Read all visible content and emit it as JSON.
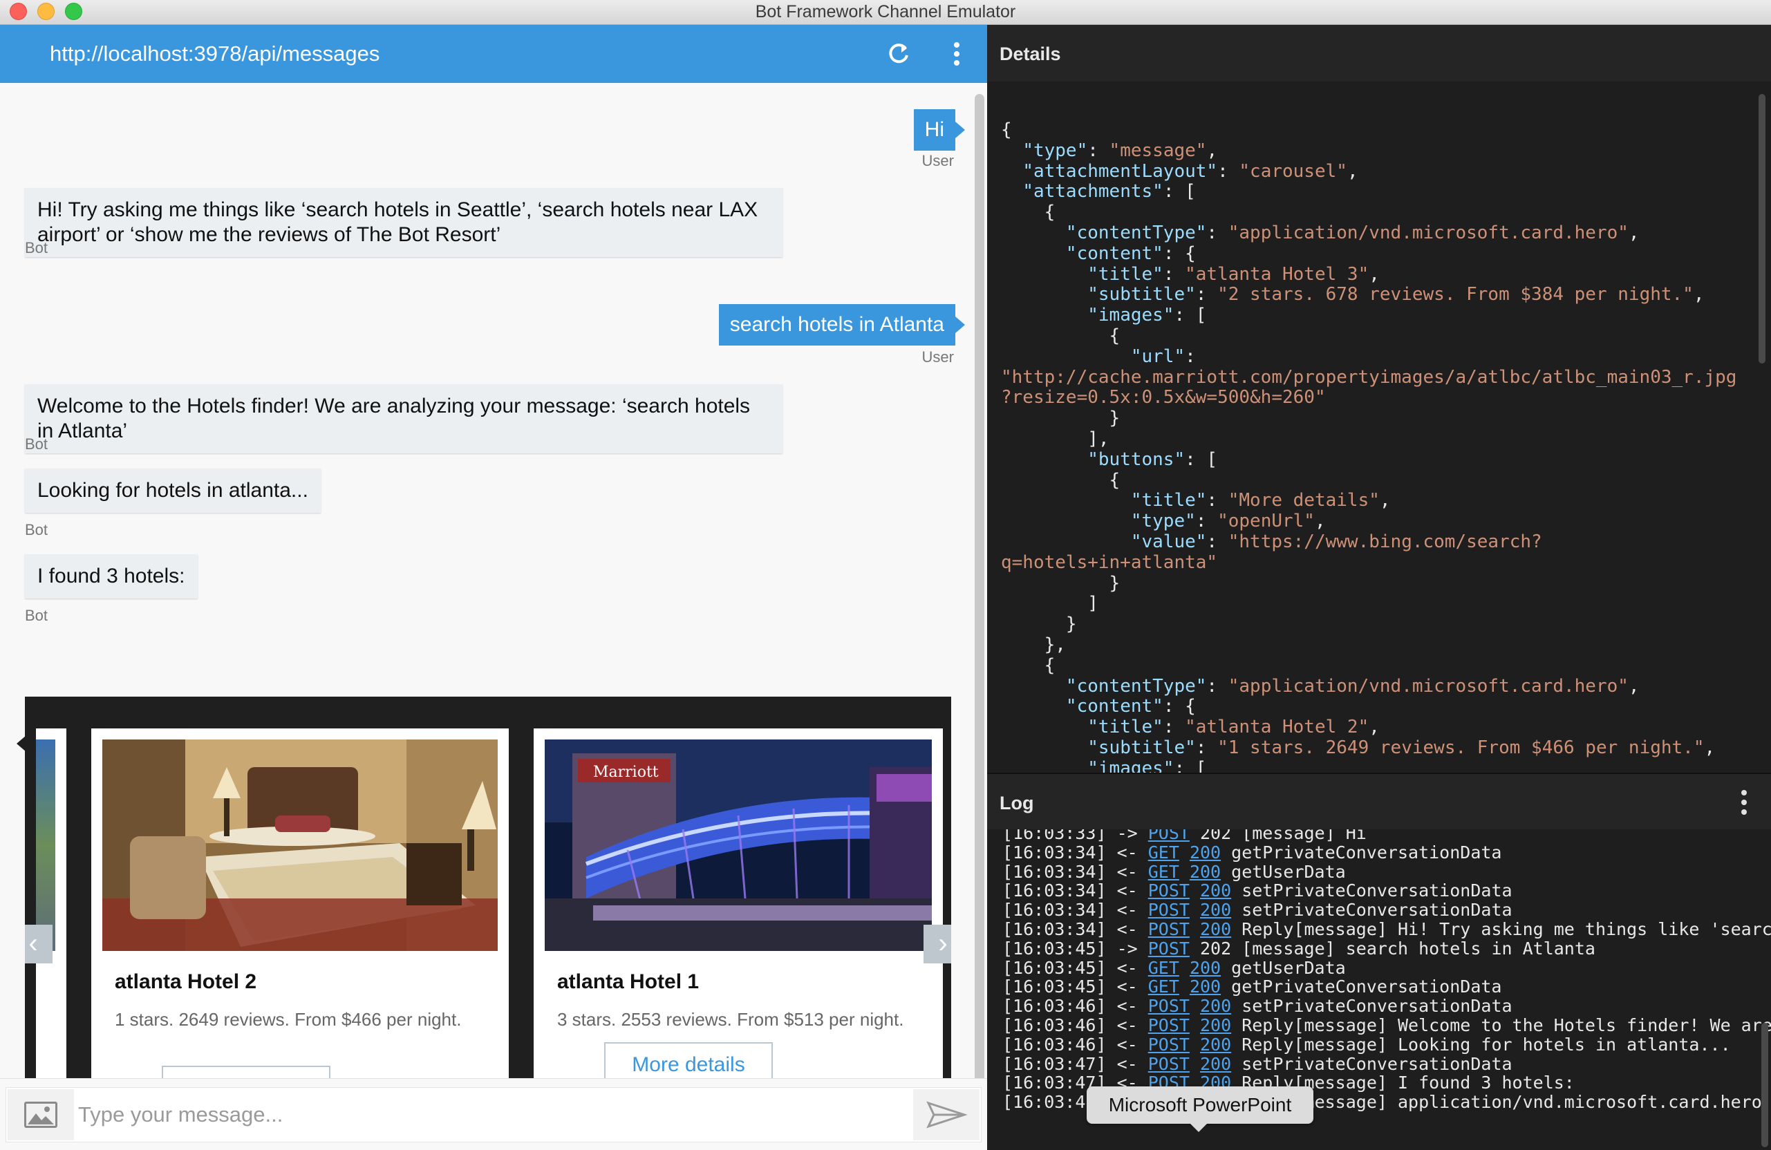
{
  "window": {
    "title": "Bot Framework Channel Emulator"
  },
  "chat": {
    "endpoint": "http://localhost:3978/api/messages",
    "messages": [
      {
        "from": "user",
        "text": "Hi",
        "sender": "User"
      },
      {
        "from": "bot",
        "text": "Hi! Try asking me things like ‘search hotels in Seattle’, ‘search hotels near LAX airport’ or ‘show me the reviews of The Bot Resort’",
        "sender": "Bot"
      },
      {
        "from": "user",
        "text": "search hotels in Atlanta",
        "sender": "User"
      },
      {
        "from": "bot",
        "text": "Welcome to the Hotels finder! We are analyzing your message: ‘search hotels in Atlanta’",
        "sender": "Bot"
      },
      {
        "from": "bot",
        "text": "Looking for hotels in atlanta...",
        "sender": "Bot"
      },
      {
        "from": "bot",
        "text": "I found 3 hotels:",
        "sender": "Bot"
      }
    ],
    "cards": [
      {
        "title": "atlanta Hotel 2",
        "subtitle": "1 stars. 2649 reviews. From $466 per night.",
        "button": "More details"
      },
      {
        "title": "atlanta Hotel 1",
        "subtitle": "3 stars. 2553 reviews. From $513 per night.",
        "button": "More details"
      }
    ],
    "input_placeholder": "Type your message..."
  },
  "details": {
    "title": "Details",
    "json_lines": [
      [
        [
          "p",
          "{"
        ]
      ],
      [
        [
          "p",
          "  "
        ],
        [
          "k",
          "\"type\""
        ],
        [
          "p",
          ": "
        ],
        [
          "s",
          "\"message\""
        ],
        [
          "p",
          ","
        ]
      ],
      [
        [
          "p",
          "  "
        ],
        [
          "k",
          "\"attachmentLayout\""
        ],
        [
          "p",
          ": "
        ],
        [
          "s",
          "\"carousel\""
        ],
        [
          "p",
          ","
        ]
      ],
      [
        [
          "p",
          "  "
        ],
        [
          "k",
          "\"attachments\""
        ],
        [
          "p",
          ": ["
        ]
      ],
      [
        [
          "p",
          "    {"
        ]
      ],
      [
        [
          "p",
          "      "
        ],
        [
          "k",
          "\"contentType\""
        ],
        [
          "p",
          ": "
        ],
        [
          "s",
          "\"application/vnd.microsoft.card.hero\""
        ],
        [
          "p",
          ","
        ]
      ],
      [
        [
          "p",
          "      "
        ],
        [
          "k",
          "\"content\""
        ],
        [
          "p",
          ": {"
        ]
      ],
      [
        [
          "p",
          "        "
        ],
        [
          "k",
          "\"title\""
        ],
        [
          "p",
          ": "
        ],
        [
          "s",
          "\"atlanta Hotel 3\""
        ],
        [
          "p",
          ","
        ]
      ],
      [
        [
          "p",
          "        "
        ],
        [
          "k",
          "\"subtitle\""
        ],
        [
          "p",
          ": "
        ],
        [
          "s",
          "\"2 stars. 678 reviews. From $384 per night.\""
        ],
        [
          "p",
          ","
        ]
      ],
      [
        [
          "p",
          "        "
        ],
        [
          "k",
          "\"images\""
        ],
        [
          "p",
          ": ["
        ]
      ],
      [
        [
          "p",
          "          {"
        ]
      ],
      [
        [
          "p",
          "            "
        ],
        [
          "k",
          "\"url\""
        ],
        [
          "p",
          ":"
        ]
      ],
      [
        [
          "s",
          "\"http://cache.marriott.com/propertyimages/a/atlbc/atlbc_main03_r.jpg"
        ]
      ],
      [
        [
          "s",
          "?resize=0.5x:0.5x&w=500&h=260\""
        ]
      ],
      [
        [
          "p",
          "          }"
        ]
      ],
      [
        [
          "p",
          "        ],"
        ]
      ],
      [
        [
          "p",
          "        "
        ],
        [
          "k",
          "\"buttons\""
        ],
        [
          "p",
          ": ["
        ]
      ],
      [
        [
          "p",
          "          {"
        ]
      ],
      [
        [
          "p",
          "            "
        ],
        [
          "k",
          "\"title\""
        ],
        [
          "p",
          ": "
        ],
        [
          "s",
          "\"More details\""
        ],
        [
          "p",
          ","
        ]
      ],
      [
        [
          "p",
          "            "
        ],
        [
          "k",
          "\"type\""
        ],
        [
          "p",
          ": "
        ],
        [
          "s",
          "\"openUrl\""
        ],
        [
          "p",
          ","
        ]
      ],
      [
        [
          "p",
          "            "
        ],
        [
          "k",
          "\"value\""
        ],
        [
          "p",
          ": "
        ],
        [
          "s",
          "\"https://www.bing.com/search?"
        ]
      ],
      [
        [
          "s",
          "q=hotels+in+atlanta\""
        ]
      ],
      [
        [
          "p",
          "          }"
        ]
      ],
      [
        [
          "p",
          "        ]"
        ]
      ],
      [
        [
          "p",
          "      }"
        ]
      ],
      [
        [
          "p",
          "    },"
        ]
      ],
      [
        [
          "p",
          "    {"
        ]
      ],
      [
        [
          "p",
          "      "
        ],
        [
          "k",
          "\"contentType\""
        ],
        [
          "p",
          ": "
        ],
        [
          "s",
          "\"application/vnd.microsoft.card.hero\""
        ],
        [
          "p",
          ","
        ]
      ],
      [
        [
          "p",
          "      "
        ],
        [
          "k",
          "\"content\""
        ],
        [
          "p",
          ": {"
        ]
      ],
      [
        [
          "p",
          "        "
        ],
        [
          "k",
          "\"title\""
        ],
        [
          "p",
          ": "
        ],
        [
          "s",
          "\"atlanta Hotel 2\""
        ],
        [
          "p",
          ","
        ]
      ],
      [
        [
          "p",
          "        "
        ],
        [
          "k",
          "\"subtitle\""
        ],
        [
          "p",
          ": "
        ],
        [
          "s",
          "\"1 stars. 2649 reviews. From $466 per night.\""
        ],
        [
          "p",
          ","
        ]
      ],
      [
        [
          "p",
          "        "
        ],
        [
          "k",
          "\"images\""
        ],
        [
          "p",
          ": ["
        ]
      ],
      [
        [
          "p",
          "          {"
        ]
      ]
    ]
  },
  "log": {
    "title": "Log",
    "entries": [
      {
        "time": "[16:03:33]",
        "dir": "->",
        "method": "POST",
        "status": "202",
        "text": "[message] Hi"
      },
      {
        "time": "[16:03:34]",
        "dir": "<-",
        "method": "GET",
        "status": "200",
        "text": "getPrivateConversationData"
      },
      {
        "time": "[16:03:34]",
        "dir": "<-",
        "method": "GET",
        "status": "200",
        "text": "getUserData"
      },
      {
        "time": "[16:03:34]",
        "dir": "<-",
        "method": "POST",
        "status": "200",
        "text": "setPrivateConversationData"
      },
      {
        "time": "[16:03:34]",
        "dir": "<-",
        "method": "POST",
        "status": "200",
        "text": "setPrivateConversationData"
      },
      {
        "time": "[16:03:34]",
        "dir": "<-",
        "method": "POST",
        "status": "200",
        "text": "Reply[message] Hi! Try asking me things like 'search"
      },
      {
        "time": "[16:03:45]",
        "dir": "->",
        "method": "POST",
        "status": "202",
        "text": "[message] search hotels in Atlanta"
      },
      {
        "time": "[16:03:45]",
        "dir": "<-",
        "method": "GET",
        "status": "200",
        "text": "getUserData"
      },
      {
        "time": "[16:03:45]",
        "dir": "<-",
        "method": "GET",
        "status": "200",
        "text": "getPrivateConversationData"
      },
      {
        "time": "[16:03:46]",
        "dir": "<-",
        "method": "POST",
        "status": "200",
        "text": "setPrivateConversationData"
      },
      {
        "time": "[16:03:46]",
        "dir": "<-",
        "method": "POST",
        "status": "200",
        "text": "Reply[message] Welcome to the Hotels finder! We are a"
      },
      {
        "time": "[16:03:46]",
        "dir": "<-",
        "method": "POST",
        "status": "200",
        "text": "Reply[message] Looking for hotels in atlanta..."
      },
      {
        "time": "[16:03:47]",
        "dir": "<-",
        "method": "POST",
        "status": "200",
        "text": "setPrivateConversationData"
      },
      {
        "time": "[16:03:47]",
        "dir": "<-",
        "method": "POST",
        "status": "200",
        "text": "Reply[message] I found 3 hotels:"
      },
      {
        "time": "[16:03:47]",
        "dir": "<-",
        "method": "POST",
        "status": "200",
        "text": "Reply[message] application/vnd.microsoft.card.hero"
      }
    ]
  },
  "tooltip": "Microsoft PowerPoint",
  "icons": {
    "refresh": "refresh-icon",
    "menu": "kebab-menu-icon",
    "image_upload": "image-icon",
    "send": "send-icon",
    "prev": "chevron-left-icon",
    "next": "chevron-right-icon"
  },
  "colors": {
    "accent": "#3a96dd",
    "panel_bg": "#1e1e1e",
    "json_key": "#9cdcfe",
    "json_string": "#ce9178",
    "log_link": "#4ea3ec"
  }
}
